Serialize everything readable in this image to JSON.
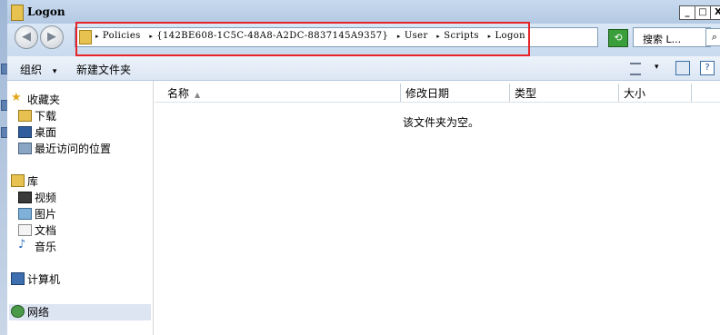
{
  "window": {
    "title": "Logon"
  },
  "title_buttons": {
    "minimize": "_",
    "maximize": "□",
    "close": "X"
  },
  "nav_buttons": {
    "back": "◀",
    "forward": "▶"
  },
  "address": {
    "segments": [
      "Policies",
      "{142BE608-1C5C-48A8-A2DC-8837145A9357}",
      "User",
      "Scripts",
      "Logon"
    ],
    "separator": "▸",
    "dropdown": "▾"
  },
  "search": {
    "text": "搜索 L...",
    "icon": "search-icon"
  },
  "toolbar": {
    "organize_label": "组织",
    "organize_arrow": "▾",
    "new_folder_label": "新建文件夹",
    "view_arrow": "▾",
    "help": "?"
  },
  "navigation": {
    "favorites": {
      "label": "收藏夹",
      "items": [
        "下载",
        "桌面",
        "最近访问的位置"
      ]
    },
    "libraries": {
      "label": "库",
      "items": [
        "视频",
        "图片",
        "文档",
        "音乐"
      ]
    },
    "computer": {
      "label": "计算机"
    },
    "network": {
      "label": "网络"
    }
  },
  "columns": [
    "名称",
    "修改日期",
    "类型",
    "大小"
  ],
  "sort_indicator": "▲",
  "empty_message": "该文件夹为空。",
  "colors": {
    "highlight_border": "#e6242a",
    "selected_bg": "#dde5f2"
  }
}
